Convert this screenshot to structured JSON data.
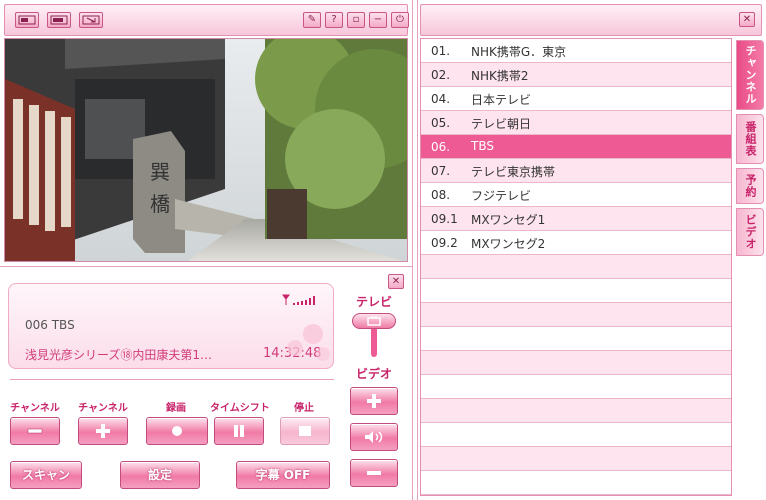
{
  "colors": {
    "accent": "#ee5a93",
    "accent_dark": "#c8246a",
    "row_alt": "#fde4ee",
    "border": "#e58fb2"
  },
  "display": {
    "channel_line": "006  TBS",
    "program": "浅見光彦シリーズ⑱内田康夫第1…",
    "time": "14:32:48"
  },
  "buttons": {
    "channel_minus_label": "チャンネル",
    "channel_plus_label": "チャンネル",
    "record_label": "録画",
    "timeshift_label": "タイムシフト",
    "stop_label": "停止",
    "scan": "スキャン",
    "settings": "設定",
    "subtitle": "字幕 OFF"
  },
  "mode": {
    "tv_label": "テレビ",
    "video_label": "ビデオ"
  },
  "channels": [
    {
      "num": "01.",
      "name": "NHK携帯G．東京"
    },
    {
      "num": "02.",
      "name": "NHK携帯2"
    },
    {
      "num": "04.",
      "name": "日本テレビ"
    },
    {
      "num": "05.",
      "name": "テレビ朝日"
    },
    {
      "num": "06.",
      "name": "TBS"
    },
    {
      "num": "07.",
      "name": "テレビ東京携帯"
    },
    {
      "num": "08.",
      "name": "フジテレビ"
    },
    {
      "num": "09.1",
      "name": "MXワンセグ1"
    },
    {
      "num": "09.2",
      "name": "MXワンセグ2"
    }
  ],
  "tabs": [
    "チャンネル",
    "番組表",
    "予約",
    "ビデオ"
  ]
}
